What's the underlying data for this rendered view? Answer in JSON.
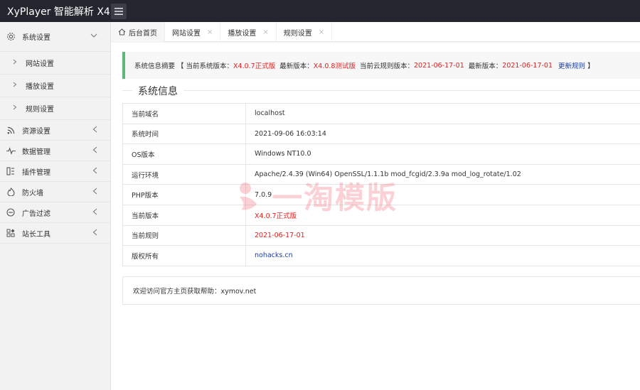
{
  "app": {
    "title": "XyPlayer 智能解析 X4"
  },
  "sidebar": {
    "items": [
      {
        "label": "系统设置",
        "icon": "gear-icon",
        "expanded": true,
        "children": [
          {
            "label": "网站设置"
          },
          {
            "label": "播放设置"
          },
          {
            "label": "规则设置"
          }
        ]
      },
      {
        "label": "资源设置",
        "icon": "rss-icon"
      },
      {
        "label": "数据管理",
        "icon": "pulse-icon"
      },
      {
        "label": "插件管理",
        "icon": "plugin-icon"
      },
      {
        "label": "防火墙",
        "icon": "fire-icon"
      },
      {
        "label": "广告过滤",
        "icon": "block-icon"
      },
      {
        "label": "站长工具",
        "icon": "apps-icon"
      }
    ]
  },
  "tabs": [
    {
      "label": "后台首页",
      "active": true
    },
    {
      "label": "网站设置",
      "close": "×"
    },
    {
      "label": "播放设置",
      "close": "×"
    },
    {
      "label": "规则设置",
      "close": "×"
    }
  ],
  "notice": {
    "prefix": "系统信息摘要 【 当前系统版本：",
    "current_version": "X4.0.7正式版",
    "latest_label": "  最新版本：",
    "latest_version": "X4.0.8测试版",
    "rule_label": "  当前云规则版本：",
    "rule_version": "2021-06-17-01",
    "rule_latest_label": "  最新版本：",
    "rule_latest_version": "2021-06-17-01",
    "update_link": "更新规则",
    "suffix": " 】"
  },
  "system_info": {
    "legend": "系统信息",
    "rows": [
      {
        "key": "当前域名",
        "value": "localhost"
      },
      {
        "key": "系统时间",
        "value": "2021-09-06 16:03:14"
      },
      {
        "key": "OS版本",
        "value": "Windows NT10.0"
      },
      {
        "key": "运行环境",
        "value": "Apache/2.4.39 (Win64) OpenSSL/1.1.1b mod_fcgid/2.3.9a mod_log_rotate/1.02"
      },
      {
        "key": "PHP版本",
        "value": "7.0.9"
      },
      {
        "key": "当前版本",
        "value": "X4.0.7正式版"
      },
      {
        "key": "当前规则",
        "value": "2021-06-17-01"
      },
      {
        "key": "版权所有",
        "value": "nohacks.cn"
      }
    ]
  },
  "help": {
    "text": "欢迎访问官方主页获取帮助：xymov.net"
  },
  "watermark": {
    "text": "一淘模版"
  },
  "colors": {
    "accent": "#5fb878",
    "header": "#23262e",
    "highlight": "#e02020",
    "link": "#1e3c9e"
  }
}
